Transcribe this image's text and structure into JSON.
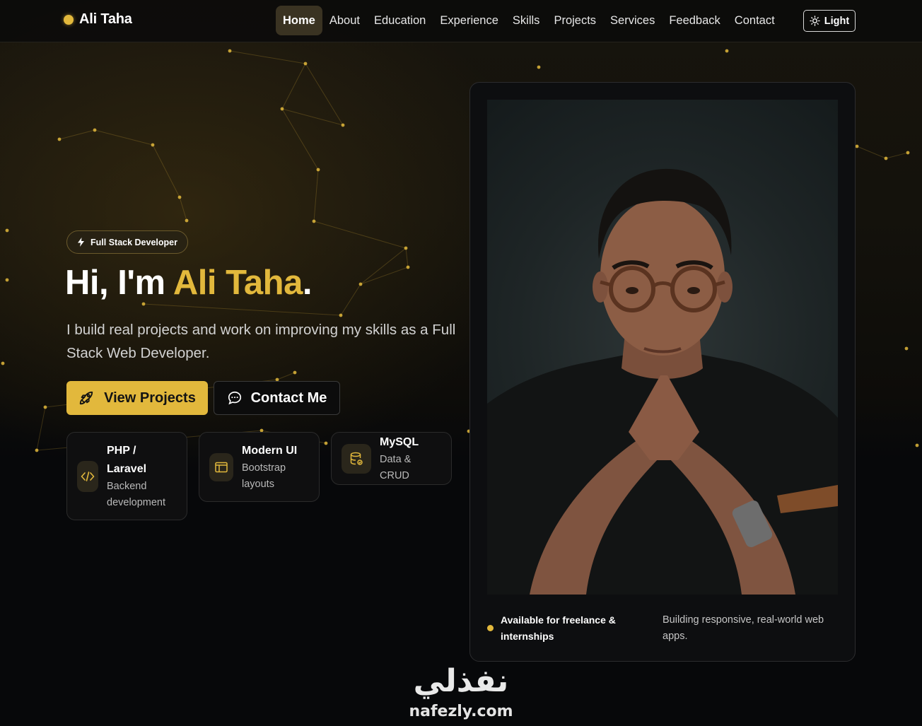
{
  "nav": {
    "brand": "Ali Taha",
    "items": [
      {
        "label": "Home",
        "active": true
      },
      {
        "label": "About",
        "active": false
      },
      {
        "label": "Education",
        "active": false
      },
      {
        "label": "Experience",
        "active": false
      },
      {
        "label": "Skills",
        "active": false
      },
      {
        "label": "Projects",
        "active": false
      },
      {
        "label": "Services",
        "active": false
      },
      {
        "label": "Feedback",
        "active": false
      },
      {
        "label": "Contact",
        "active": false
      }
    ],
    "theme_toggle": {
      "label": "Light",
      "icon": "sun-icon"
    }
  },
  "hero": {
    "badge": {
      "label": "Full Stack Developer",
      "icon": "bolt-icon"
    },
    "title_prefix": "Hi, I'm ",
    "title_name": "Ali Taha",
    "title_suffix": ".",
    "subtitle": "I build real projects and work on improving my skills as a Full Stack Web Developer.",
    "primary_button": {
      "label": "View Projects",
      "icon": "rocket-icon"
    },
    "secondary_button": {
      "label": "Contact Me",
      "icon": "chat-bubble-icon"
    },
    "features": [
      {
        "title": "PHP / Laravel",
        "desc": "Backend development",
        "icon": "code-icon"
      },
      {
        "title": "Modern UI",
        "desc": "Bootstrap layouts",
        "icon": "window-icon"
      },
      {
        "title": "MySQL",
        "desc": "Data & CRUD",
        "icon": "database-icon"
      }
    ]
  },
  "profile_card": {
    "photo": "portrait-photo",
    "status": "Available for freelance & internships",
    "note": "Building responsive, real-world web apps."
  },
  "watermark": {
    "arabic": "نفذلي",
    "latin": "nafezly.com"
  },
  "colors": {
    "accent": "#e2b83c",
    "background": "#08090b",
    "card": "#0d0e10"
  }
}
